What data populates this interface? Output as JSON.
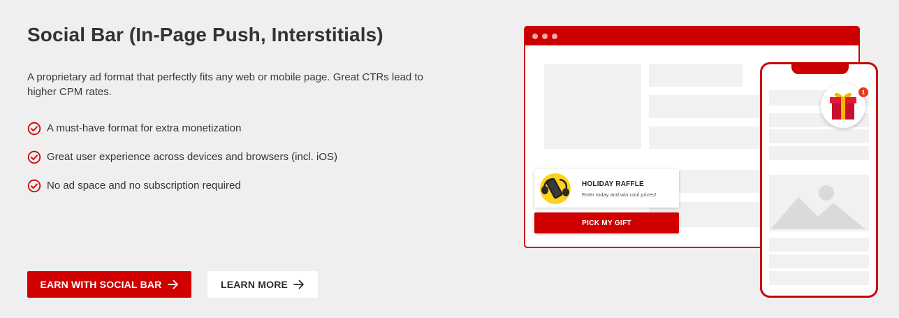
{
  "heading": "Social Bar (In-Page Push, Interstitials)",
  "description": "A proprietary ad format that perfectly fits any web or mobile page. Great CTRs lead to higher CPM rates.",
  "features": [
    "A must-have format for extra monetization",
    "Great user experience across devices and browsers (incl. iOS)",
    "No ad space and no subscription required"
  ],
  "buttons": {
    "primary": "EARN WITH SOCIAL BAR",
    "secondary": "LEARN MORE"
  },
  "illustration": {
    "push_title": "HOLIDAY RAFFLE",
    "push_subtitle": "Enter today and win cool prizes!",
    "cta": "PICK MY GIFT",
    "badge_count": "1"
  },
  "colors": {
    "accent": "#d00000",
    "background": "#efefef",
    "notification_badge": "#e63b16",
    "push_icon_bg": "#ffd21f"
  },
  "icons": {
    "feature_icon": "check-circle-icon",
    "button_icon": "arrow-right-icon",
    "gift_icon": "gift-box-icon",
    "image_placeholder": "image-placeholder-icon"
  }
}
